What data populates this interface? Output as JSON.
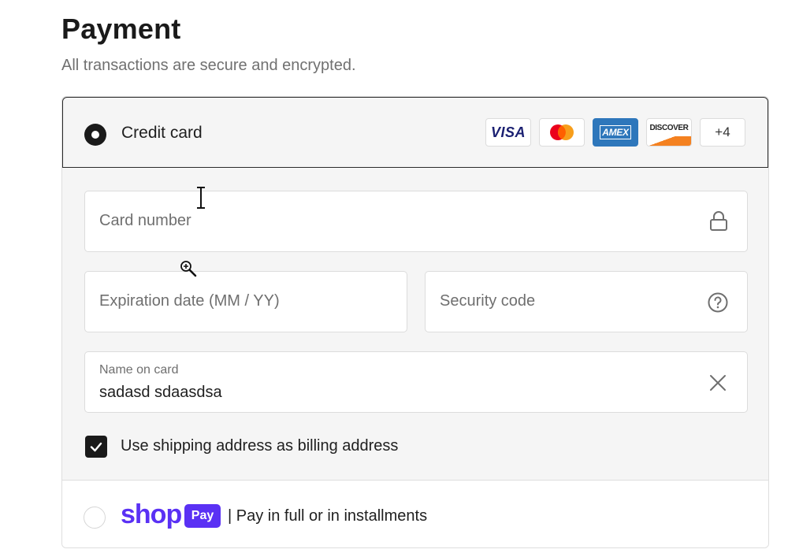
{
  "header": {
    "title": "Payment",
    "subtitle": "All transactions are secure and encrypted."
  },
  "credit_card": {
    "label": "Credit card",
    "selected": true,
    "logos": {
      "visa": "VISA",
      "amex": "AMEX",
      "discover": "DISCOVER",
      "more": "+4"
    }
  },
  "fields": {
    "card_number": {
      "placeholder": "Card number",
      "icon": "lock-icon"
    },
    "expiration": {
      "placeholder": "Expiration date (MM / YY)"
    },
    "security_code": {
      "placeholder": "Security code",
      "icon": "help-circle-icon"
    },
    "name_on_card": {
      "label": "Name on card",
      "value": "sadasd sdaasdsa",
      "icon": "clear-x-icon"
    }
  },
  "billing": {
    "label": "Use shipping address as billing address",
    "checked": true
  },
  "shop_pay": {
    "brand": "shop",
    "badge": "Pay",
    "text": "| Pay in full or in installments",
    "selected": false
  },
  "colors": {
    "shop_purple": "#5a31f4",
    "amex_blue": "#2e77bb",
    "discover_orange": "#f48120",
    "visa_navy": "#1a1f71"
  }
}
